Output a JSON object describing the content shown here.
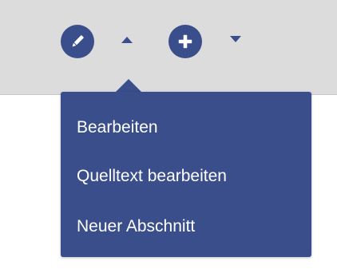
{
  "toolbar": {
    "edit_button_icon": "pencil-icon",
    "edit_menu_toggle_icon": "caret-up-icon",
    "add_button_icon": "plus-icon",
    "add_menu_toggle_icon": "caret-down-icon",
    "accent_color": "#3a4e8c",
    "background_color": "#dcdcdc"
  },
  "edit_menu": {
    "items": [
      {
        "label": "Bearbeiten"
      },
      {
        "label": "Quelltext bearbeiten"
      },
      {
        "label": "Neuer Abschnitt"
      }
    ],
    "background_color": "#3a4e8c",
    "text_color": "#ffffff"
  }
}
